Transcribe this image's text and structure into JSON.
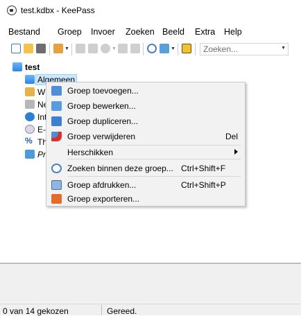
{
  "window": {
    "title": "test.kdbx - KeePass"
  },
  "menu": [
    "Bestand",
    "Groep",
    "Invoer",
    "Zoeken",
    "Beeld",
    "Extra",
    "Help"
  ],
  "toolbar": {
    "icons": [
      "new-database-icon",
      "open-database-icon",
      "save-icon",
      "add-entry-icon",
      "copy-username-icon",
      "copy-password-icon",
      "open-url-icon",
      "copy-entry-icon",
      "delete-entry-icon",
      "find-icon",
      "generate-password-icon",
      "lock-workspace-icon"
    ],
    "search_placeholder": "Zoeken..."
  },
  "tree": {
    "root": "test",
    "items": [
      {
        "label": "Algemeen",
        "icon": "folder-icon",
        "selected": true
      },
      {
        "label": "Wi",
        "icon": "windows-icon"
      },
      {
        "label": "Ne",
        "icon": "network-icon"
      },
      {
        "label": "Int",
        "icon": "internet-icon"
      },
      {
        "label": "E-r",
        "icon": "email-icon"
      },
      {
        "label": "Th",
        "icon": "homebanking-icon"
      },
      {
        "label": "Pr",
        "icon": "recycle-bin-icon",
        "italic": true
      }
    ]
  },
  "context_menu": {
    "items": [
      {
        "label": "Groep toevoegen...",
        "icon": "group-add-icon",
        "shortcut": ""
      },
      {
        "label": "Groep bewerken...",
        "icon": "group-edit-icon",
        "shortcut": ""
      },
      {
        "label": "Groep dupliceren...",
        "icon": "group-duplicate-icon",
        "shortcut": ""
      },
      {
        "label": "Groep verwijderen",
        "icon": "group-delete-icon",
        "shortcut": "Del"
      },
      {
        "label": "Herschikken",
        "icon": "",
        "shortcut": "",
        "submenu": true
      },
      {
        "label": "Zoeken binnen deze groep...",
        "icon": "search-icon",
        "shortcut": "Ctrl+Shift+F"
      },
      {
        "label": "Groep afdrukken...",
        "icon": "print-icon",
        "shortcut": "Ctrl+Shift+P"
      },
      {
        "label": "Groep exporteren...",
        "icon": "export-icon",
        "shortcut": ""
      }
    ]
  },
  "status": {
    "selection": "0 van 14 gekozen",
    "state": "Gereed."
  }
}
